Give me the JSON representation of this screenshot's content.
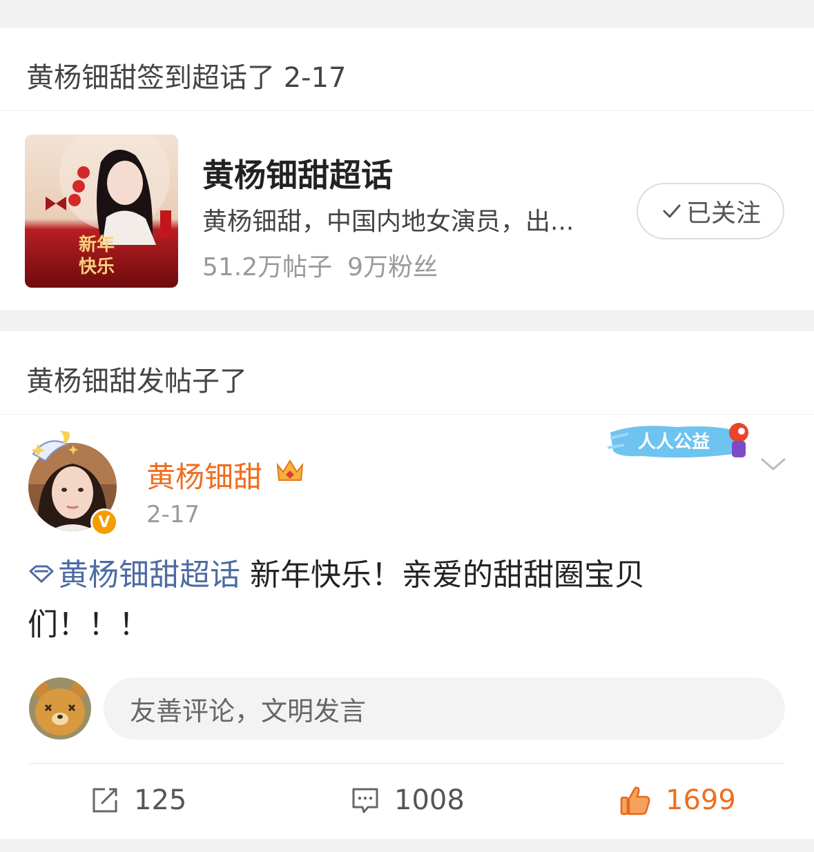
{
  "checkin_card": {
    "header": "黄杨钿甜签到超话了 2-17",
    "topic": {
      "title": "黄杨钿甜超话",
      "description": "黄杨钿甜，中国内地女演员，出...",
      "posts": "51.2万帖子",
      "fans": "9万粉丝",
      "follow_label": "已关注",
      "cover_text_line1": "新年",
      "cover_text_line2": "快乐"
    }
  },
  "post_card": {
    "header": "黄杨钿甜发帖子了",
    "author": {
      "name": "黄杨钿甜",
      "verified_badge": "V",
      "time": "2-17",
      "banner_text": "人人公益"
    },
    "content": {
      "topic_link": "黄杨钿甜超话",
      "text": " 新年快乐！亲爱的甜甜圈宝贝们！！！"
    },
    "comment_placeholder": "友善评论，文明发言",
    "actions": {
      "repost_count": "125",
      "comment_count": "1008",
      "like_count": "1699"
    }
  },
  "colors": {
    "accent_orange": "#f06d1f",
    "topic_blue": "#4d6ba3",
    "muted_gray": "#999999"
  },
  "icons": [
    "checkmark-icon",
    "avatar-decoration-icon",
    "crown-icon",
    "chevron-down-icon",
    "diamond-topic-icon",
    "repost-icon",
    "comment-icon",
    "like-icon"
  ]
}
